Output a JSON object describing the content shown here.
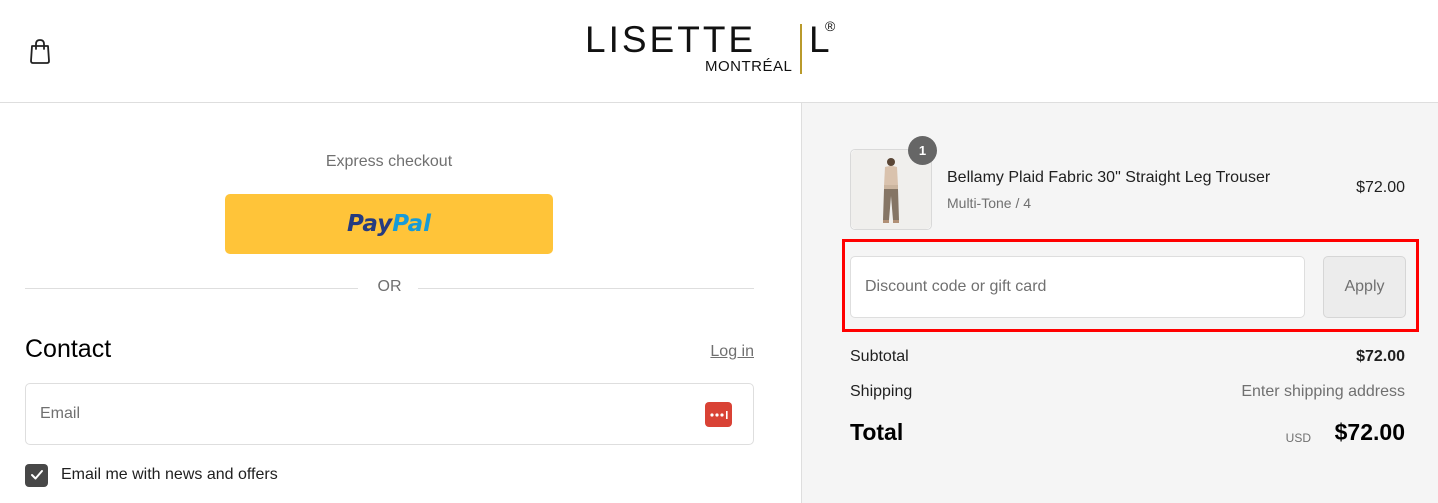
{
  "header": {
    "logo_main": "LISETTE",
    "logo_letter": "L",
    "logo_registered": "®",
    "logo_sub": "MONTRÉAL",
    "cart_icon": "shopping-bag-icon",
    "accent_color": "#b99a2b"
  },
  "express": {
    "label": "Express checkout",
    "paypal_pay": "Pay",
    "paypal_pal": "Pal",
    "paypal_color": "#ffc439"
  },
  "divider": {
    "or_text": "OR"
  },
  "contact": {
    "title": "Contact",
    "login_label": "Log in",
    "email_placeholder": "Email",
    "password_manager_icon": "password-manager-icon",
    "newsletter_label": "Email me with news and offers",
    "newsletter_checked": true
  },
  "order": {
    "item": {
      "quantity": "1",
      "name": "Bellamy Plaid Fabric 30\" Straight Leg Trouser",
      "variant": "Multi-Tone / 4",
      "price": "$72.00"
    },
    "discount": {
      "placeholder": "Discount code or gift card",
      "apply_label": "Apply",
      "highlight_color": "#ff0000"
    },
    "subtotal_label": "Subtotal",
    "subtotal_value": "$72.00",
    "shipping_label": "Shipping",
    "shipping_value": "Enter shipping address",
    "total_label": "Total",
    "total_currency": "USD",
    "total_value": "$72.00"
  }
}
